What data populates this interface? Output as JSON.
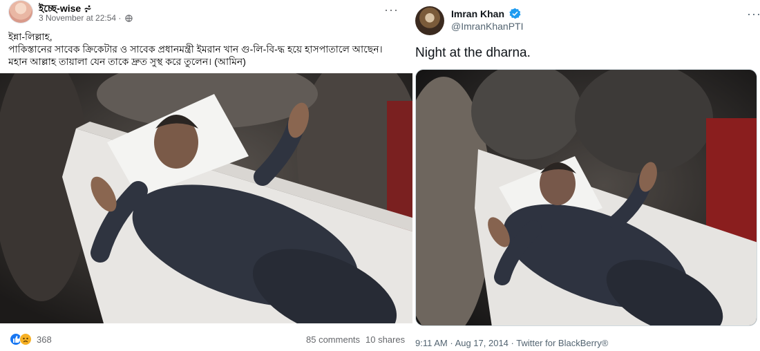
{
  "facebook_post": {
    "author": "ইচ্ছে-wise ⩫",
    "date": "3 November at 22:54 ·",
    "text_lines": [
      "ইন্না-লিল্লাহ,",
      "পাকিস্তানের সাবেক ক্রিকেটার ও সাবেক প্রধানমন্ত্রী ইমরান খান গু-লি-বি-দ্ধ হয়ে হাসপাতালে আছেন।",
      "মহান আল্লাহ তায়ালা যেন তাকে দ্রুত সুস্থ করে তুলেন। (আমিন)"
    ],
    "reaction_count": "368",
    "comments": "85 comments",
    "shares": "10 shares",
    "reaction_icons": [
      "like-icon",
      "sad-icon"
    ]
  },
  "tweet": {
    "display_name": "Imran Khan",
    "handle": "@ImranKhanPTI",
    "text": "Night at the dharna.",
    "meta": "9:11 AM · Aug 17, 2014 · Twitter for BlackBerry®",
    "verified_color": "#1d9bf0"
  },
  "colors": {
    "fb_secondary_text": "#65676b",
    "fb_like_blue": "#1877f2",
    "fb_sad_yellow": "#f7b125",
    "tw_secondary_text": "#536471"
  }
}
